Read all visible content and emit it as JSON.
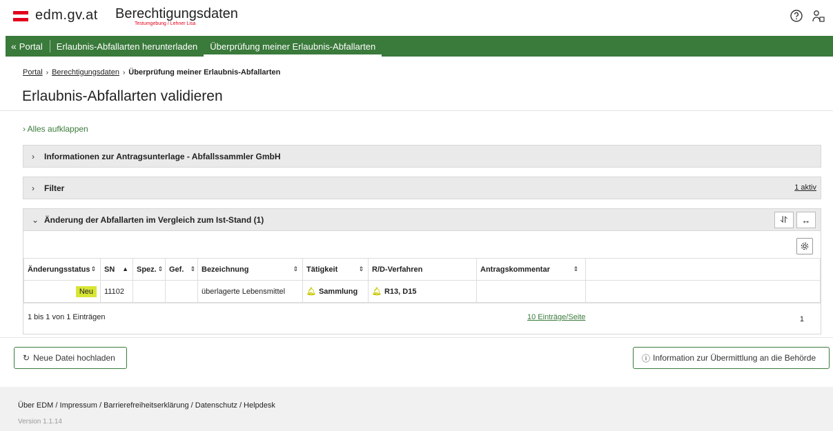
{
  "header": {
    "site_name": "edm.gv.at",
    "app_title": "Berechtigungsdaten",
    "app_subtitle": "Testumgebung / Lehner Lisa",
    "help_icon": "help-circle-icon",
    "user_icon": "user-icon"
  },
  "nav": {
    "portal": "Portal",
    "items": [
      "Erlaubnis-Abfallarten herunterladen",
      "Überprüfung meiner Erlaubnis-Abfallarten"
    ]
  },
  "breadcrumb": {
    "items": [
      "Portal",
      "Berechtigungsdaten",
      "Überprüfung meiner Erlaubnis-Abfallarten"
    ]
  },
  "page_title": "Erlaubnis-Abfallarten validieren",
  "expand_all": "Alles aufklappen",
  "panels": {
    "info": {
      "title": "Informationen zur Antragsunterlage - Abfallssammler GmbH"
    },
    "filter": {
      "title": "Filter",
      "active": "1 aktiv"
    },
    "changes": {
      "title": "Änderung der Abfallarten im Vergleich zum Ist-Stand (1)"
    }
  },
  "table": {
    "columns": [
      "Änderungsstatus",
      "SN",
      "Spez.",
      "Gef.",
      "Bezeichnung",
      "Tätigkeit",
      "R/D-Verfahren",
      "Antragskommentar",
      ""
    ],
    "rows": [
      {
        "status": "Neu",
        "sn": "11102",
        "spez": "",
        "gef": "",
        "bezeichnung": "überlagerte Lebensmittel",
        "taetigkeit": "Sammlung",
        "verfahren": "R13, D15",
        "kommentar": ""
      }
    ],
    "summary": "1 bis 1 von 1 Einträgen",
    "page_size": "10 Einträge/Seite",
    "page": "1"
  },
  "actions": {
    "upload": "Neue Datei hochladen",
    "info": "Information zur Übermittlung an die Behörde"
  },
  "footer": {
    "links": "Über EDM / Impressum / Barrierefreiheitserklärung / Datenschutz / Helpdesk",
    "version": "Version 1.1.14"
  },
  "colors": {
    "brand_green": "#3a7a3b",
    "austria_red": "#e2001a",
    "badge_new": "#d7e535"
  }
}
